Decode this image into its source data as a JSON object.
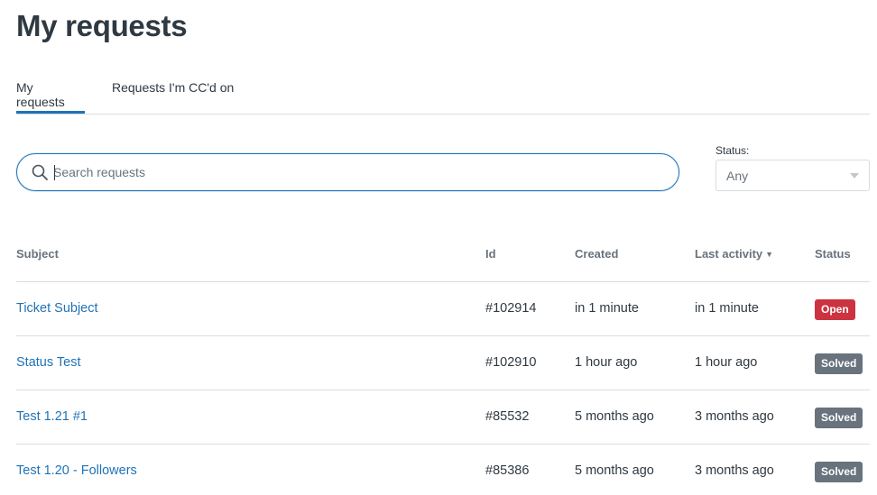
{
  "page_title": "My requests",
  "tabs": [
    {
      "label": "My requests",
      "active": true
    },
    {
      "label": "Requests I'm CC'd on",
      "active": false
    }
  ],
  "search": {
    "placeholder": "Search requests",
    "value": ""
  },
  "status_filter": {
    "label": "Status:",
    "selected": "Any"
  },
  "table": {
    "columns": {
      "subject": "Subject",
      "id": "Id",
      "created": "Created",
      "last_activity": "Last activity",
      "sort_indicator": "▼",
      "status": "Status"
    },
    "rows": [
      {
        "subject": "Ticket Subject",
        "id": "#102914",
        "created": "in 1 minute",
        "last_activity": "in 1 minute",
        "status": "Open"
      },
      {
        "subject": "Status Test",
        "id": "#102910",
        "created": "1 hour ago",
        "last_activity": "1 hour ago",
        "status": "Solved"
      },
      {
        "subject": "Test 1.21 #1",
        "id": "#85532",
        "created": "5 months ago",
        "last_activity": "3 months ago",
        "status": "Solved"
      },
      {
        "subject": "Test 1.20 - Followers",
        "id": "#85386",
        "created": "5 months ago",
        "last_activity": "3 months ago",
        "status": "Solved"
      }
    ]
  },
  "colors": {
    "accent": "#1f73b7",
    "open_badge": "#cc3340",
    "solved_badge": "#68737d",
    "divider": "#d8dcde"
  }
}
